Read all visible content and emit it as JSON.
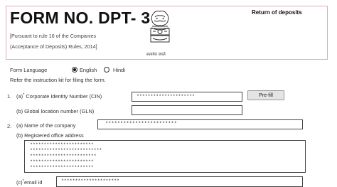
{
  "header": {
    "form_title": "FORM NO. DPT- 3",
    "return_title": "Return of deposits",
    "pursuant_line1": "[Pursuant to rule 16 of the Companies",
    "pursuant_line2": "(Acceptance of Deposits) Rules, 2014]",
    "emblem_caption": "सत्यमेव जयते"
  },
  "language": {
    "label": "Form Language",
    "options": [
      "English",
      "Hindi"
    ],
    "selected": "English"
  },
  "instruction_text": "Refer the instruction kit for filing the form.",
  "section1": {
    "number": "1.",
    "cin_label_prefix": "(a)",
    "cin_required_mark": "*",
    "cin_label": "Corporate Identity Number (CIN)",
    "cin_value": "*********************",
    "prefill_label": "Pre-fill",
    "gln_label": "(b) Global location number (GLN)",
    "gln_value": ""
  },
  "section2": {
    "number": "2.",
    "name_label": "(a) Name of the company",
    "name_value": "************************",
    "address_label": "(b) Registered office address",
    "address_lines": [
      "***********************",
      "**************************",
      "************************",
      "***********************",
      "***********************"
    ],
    "email_label_prefix": "(c)",
    "email_required_mark": "*",
    "email_label": "email id",
    "email_value": "*********************"
  }
}
